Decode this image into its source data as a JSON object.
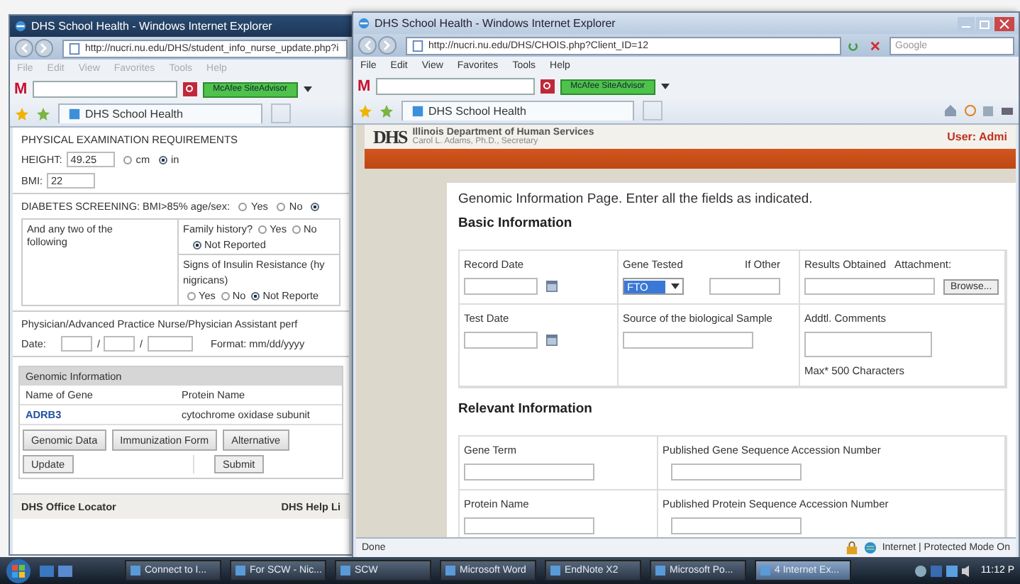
{
  "back_window": {
    "title": "DHS School Health - Windows Internet Explorer",
    "address": "http://nucri.nu.edu/DHS/student_info_nurse_update.php?i",
    "menu": [
      "File",
      "Edit",
      "View",
      "Favorites",
      "Tools",
      "Help"
    ],
    "logo_letter": "M",
    "toolbar_button": "McAfee SiteAdvisor",
    "tab": "DHS School Health",
    "section_title": "PHYSICAL EXAMINATION REQUIREMENTS",
    "height": {
      "label": "HEIGHT:",
      "value": "49.25",
      "options": [
        {
          "label": "cm",
          "selected": false
        },
        {
          "label": "in",
          "selected": true
        }
      ]
    },
    "bmi": {
      "label": "BMI:",
      "value": "22"
    },
    "diabetes": {
      "label": "DIABETES SCREENING: BMI>85% age/sex:",
      "options": [
        {
          "label": "Yes",
          "selected": false
        },
        {
          "label": "No",
          "selected": false
        },
        {
          "selected": true
        }
      ]
    },
    "criteria_label": "And any two of the following",
    "criteria": [
      {
        "question": [
          "Family history?"
        ],
        "options": [
          {
            "label": "Yes",
            "selected": false
          },
          {
            "label": "No",
            "selected": false
          },
          {
            "label": "Not Reported",
            "selected": true
          }
        ]
      },
      {
        "question": [
          "Signs of Insulin Resistance (hy",
          "nigricans)"
        ],
        "options": [
          {
            "label": "Yes",
            "selected": false
          },
          {
            "label": "No",
            "selected": false
          },
          {
            "label": "Not Reporte",
            "selected": true
          }
        ]
      }
    ],
    "physician_text": "Physician/Advanced Practice Nurse/Physician Assistant perf",
    "date": {
      "label": "Date:",
      "separators": [
        "/",
        "/"
      ],
      "format": "Format: mm/dd/yyyy"
    },
    "genomic": {
      "title": "Genomic Information",
      "columns": [
        "Name of Gene",
        "Protein Name"
      ],
      "row": [
        "ADRB3",
        "cytochrome oxidase subunit"
      ]
    },
    "buttons": [
      "Genomic Data",
      "Immunization Form",
      "Alternative"
    ],
    "actions": [
      "Update",
      "Submit"
    ],
    "footer": [
      "DHS Office Locator",
      "DHS Help Li"
    ]
  },
  "front_window": {
    "title": "DHS School Health - Windows Internet Explorer",
    "address": "http://nucri.nu.edu/DHS/CHOIS.php?Client_ID=12",
    "search": {
      "placeholder": "Google"
    },
    "menu": [
      "File",
      "Edit",
      "View",
      "Favorites",
      "Tools",
      "Help"
    ],
    "logo_letter": "M",
    "toolbar_button": "McAfee SiteAdvisor",
    "tab": "DHS School Health",
    "header": {
      "logo": "DHS",
      "agency": "Illinois Department of Human Services",
      "secretary": "Carol L. Adams, Ph.D., Secretary",
      "user": "User: Admi"
    },
    "intro": "Genomic Information Page. Enter all the fields as indicated.",
    "basic_title": "Basic Information",
    "record_date": "Record Date",
    "gene_tested": {
      "label": "Gene Tested",
      "value": "FTO"
    },
    "if_other": "If Other",
    "results": "Results Obtained",
    "attachment": "Attachment:",
    "browse": "Browse...",
    "test_date": "Test Date",
    "source": "Source of the biological Sample",
    "comments": "Addtl. Comments",
    "max_note": "Max* 500 Characters",
    "relevant_title": "Relevant Information",
    "relevant_rows": [
      [
        "Gene Term",
        "Published Gene Sequence Accession Number"
      ],
      [
        "Protein Name",
        "Published Protein Sequence Accession Number"
      ]
    ],
    "status": {
      "text": "Done",
      "zone": "Internet | Protected Mode On"
    }
  },
  "taskbar": {
    "items": [
      {
        "label": "Connect to I...",
        "selected": false
      },
      {
        "label": "For SCW - Nic...",
        "selected": false
      },
      {
        "label": "SCW",
        "selected": false
      },
      {
        "label": "Microsoft Word",
        "selected": false
      },
      {
        "label": "EndNote X2",
        "selected": false
      },
      {
        "label": "Microsoft Po...",
        "selected": false
      },
      {
        "label": "4 Internet Ex...",
        "selected": true
      }
    ],
    "clock": "11:12 P"
  }
}
